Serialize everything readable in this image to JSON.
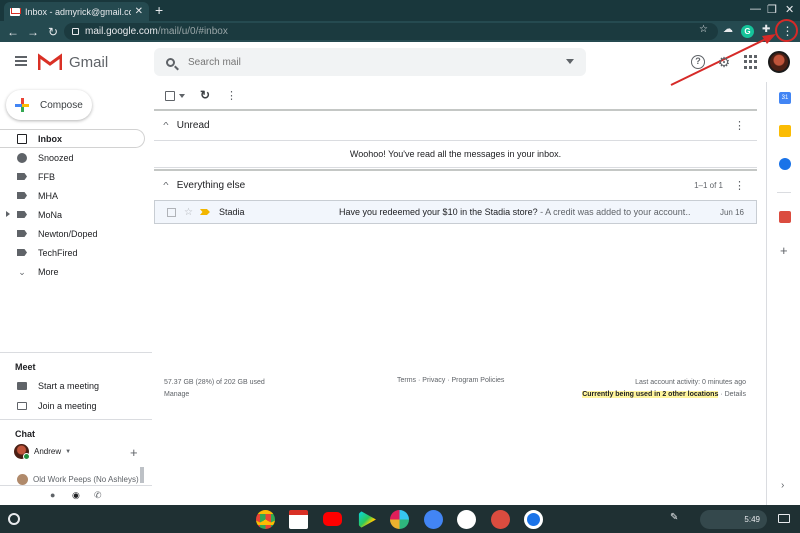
{
  "browser": {
    "tab_title": "Inbox - admyrick@gmail.com - G",
    "tab_close": "✕",
    "new_tab": "+",
    "url_host": "mail.google.com",
    "url_path": "/mail/u/0/#inbox",
    "window_controls": [
      "—",
      "❐",
      "✕"
    ]
  },
  "gmail": {
    "product_name": "Gmail",
    "search_placeholder": "Search mail",
    "help_glyph": "?",
    "settings_glyph": "⚙"
  },
  "compose_label": "Compose",
  "nav": {
    "items": [
      {
        "label": "Inbox",
        "icon": "inbox-icon"
      },
      {
        "label": "Snoozed",
        "icon": "clock-icon"
      },
      {
        "label": "FFB",
        "icon": "label-icon"
      },
      {
        "label": "MHA",
        "icon": "label-icon"
      },
      {
        "label": "MoNa",
        "icon": "label-icon"
      },
      {
        "label": "Newton/Doped",
        "icon": "label-icon"
      },
      {
        "label": "TechFired",
        "icon": "label-icon"
      },
      {
        "label": "More",
        "icon": "chevron-down-icon"
      }
    ]
  },
  "meet": {
    "title": "Meet",
    "start": "Start a meeting",
    "join": "Join a meeting"
  },
  "chat": {
    "title": "Chat",
    "user": "Andrew",
    "group": "Old Work Peeps (No Ashleys)"
  },
  "sections": {
    "unread": {
      "title": "Unread",
      "empty_message": "Woohoo! You've read all the messages in your inbox."
    },
    "everything_else": {
      "title": "Everything else",
      "count": "1–1 of 1"
    }
  },
  "emails": [
    {
      "sender": "Stadia",
      "subject": "Have you redeemed your $10 in the Stadia store?",
      "snippet": " - A credit was added to your account",
      "ellipsis": "...",
      "date": "Jun 16"
    }
  ],
  "footer": {
    "storage": "57.37 GB (28%) of 202 GB used",
    "manage": "Manage",
    "terms": "Terms",
    "privacy": "Privacy",
    "policies": "Program Policies",
    "separator": " · ",
    "activity": "Last account activity: 0 minutes ago",
    "locations": "Currently being used in 2 other locations",
    "details": "Details"
  },
  "side_panel": {
    "calendar_day": "31"
  },
  "shelf": {
    "time": "5:49"
  },
  "colors": {
    "chrome_frame": "#19373c",
    "chrome_toolbar": "#254a50",
    "annotation_red": "#d62a28",
    "highlight": "#fff59d",
    "shelf": "#1f3033"
  }
}
